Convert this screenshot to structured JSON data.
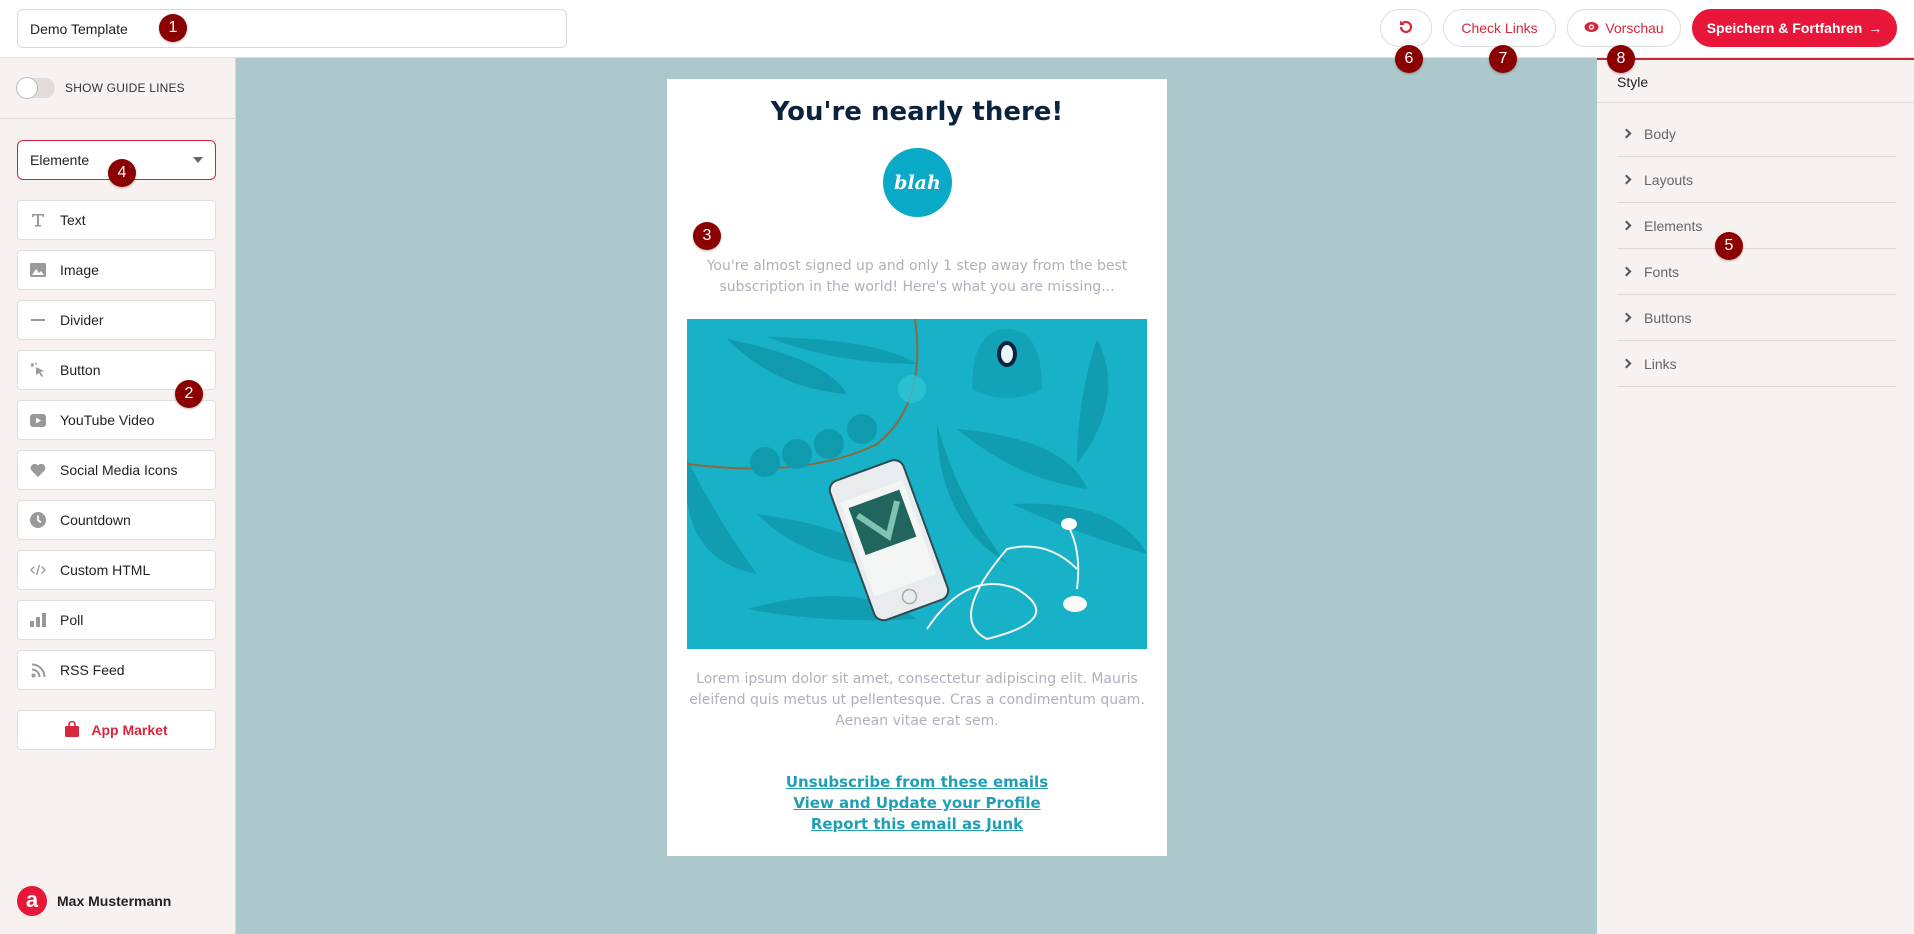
{
  "header": {
    "template_name": "Demo Template",
    "buttons": {
      "undo": "undo-icon",
      "check_links": "Check Links",
      "preview": "Vorschau",
      "save_continue": "Speichern & Fortfahren"
    }
  },
  "badges": [
    "1",
    "2",
    "3",
    "4",
    "5",
    "6",
    "7",
    "8"
  ],
  "sidebar": {
    "guide_lines_label": "SHOW GUIDE LINES",
    "guide_lines_on": false,
    "dropdown_value": "Elemente",
    "elements": [
      {
        "label": "Text",
        "icon": "text-icon"
      },
      {
        "label": "Image",
        "icon": "image-icon"
      },
      {
        "label": "Divider",
        "icon": "divider-icon"
      },
      {
        "label": "Button",
        "icon": "cursor-click-icon"
      },
      {
        "label": "YouTube Video",
        "icon": "youtube-icon"
      },
      {
        "label": "Social Media Icons",
        "icon": "heart-icon"
      },
      {
        "label": "Countdown",
        "icon": "clock-icon"
      },
      {
        "label": "Custom HTML",
        "icon": "code-icon"
      },
      {
        "label": "Poll",
        "icon": "bar-chart-icon"
      },
      {
        "label": "RSS Feed",
        "icon": "rss-icon"
      }
    ],
    "app_market": "App Market",
    "user_name": "Max Mustermann",
    "user_logo_letter": "a"
  },
  "email": {
    "heading": "You're nearly there!",
    "logo_text": "blah",
    "intro": "You're almost signed up and only 1 step away from the best subscription in the world! Here's what you are missing...",
    "body": "Lorem ipsum dolor sit amet, consectetur adipiscing elit. Mauris eleifend quis metus ut pellentesque. Cras a condimentum quam. Aenean vitae erat sem.",
    "links": [
      "Unsubscribe from these emails",
      "View and Update your Profile",
      "Report this email as Junk"
    ]
  },
  "style_panel": {
    "title": "Style",
    "sections": [
      "Body",
      "Layouts",
      "Elements",
      "Fonts",
      "Buttons",
      "Links"
    ]
  },
  "colors": {
    "brand": "#e8173a",
    "canvas_bg": "#adc8cc",
    "badge": "#8b0000",
    "link": "#1f9fb5"
  }
}
